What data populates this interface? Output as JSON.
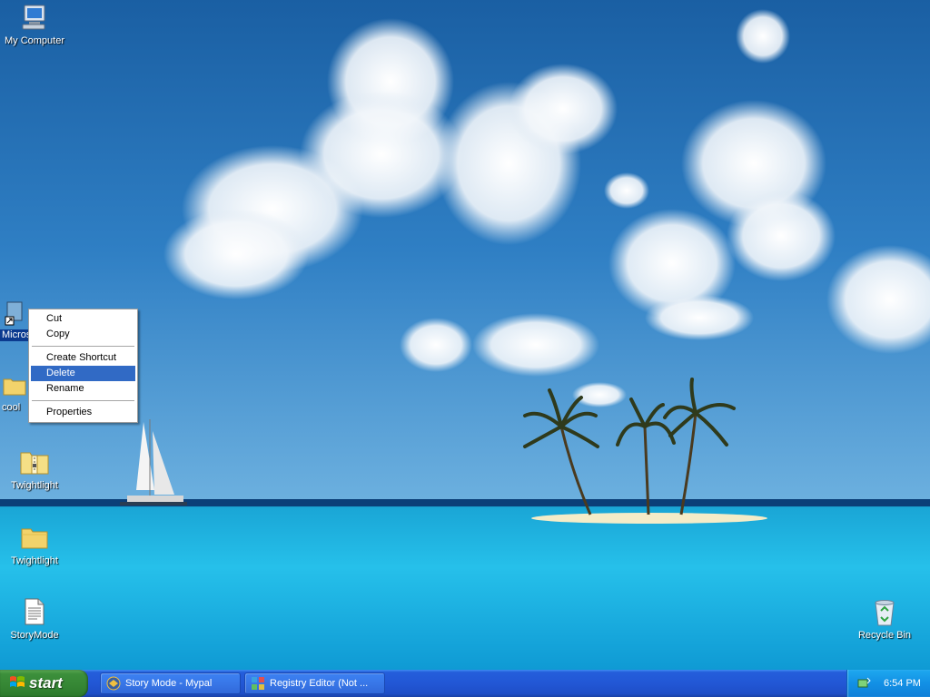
{
  "desktop": {
    "icons": [
      {
        "label": "My Computer",
        "icon": "my-computer-icon"
      },
      {
        "label": "Microsoft Bas",
        "icon": "shortcut-icon"
      },
      {
        "label": "cool",
        "icon": "folder-icon"
      },
      {
        "label": "Twightlight",
        "icon": "zip-folder-icon"
      },
      {
        "label": "Twightlight",
        "icon": "folder-icon"
      },
      {
        "label": "StoryMode",
        "icon": "text-document-icon"
      },
      {
        "label": "Recycle Bin",
        "icon": "recycle-bin-icon"
      }
    ]
  },
  "context_menu": {
    "items": [
      "Cut",
      "Copy",
      "Create Shortcut",
      "Delete",
      "Rename",
      "Properties"
    ],
    "highlighted": "Delete"
  },
  "taskbar": {
    "start_label": "start",
    "tasks": [
      {
        "label": "Story Mode - Mypal",
        "icon": "mypal-browser-icon"
      },
      {
        "label": "Registry Editor (Not ...",
        "icon": "registry-editor-icon"
      }
    ],
    "clock": "6:54 PM",
    "tray_icon": "safely-remove-hardware-icon"
  },
  "colors": {
    "taskbar_blue": "#245edb",
    "start_green": "#3c8f3b",
    "menu_highlight": "#316ac5",
    "tray_blue": "#0f7fd8"
  }
}
